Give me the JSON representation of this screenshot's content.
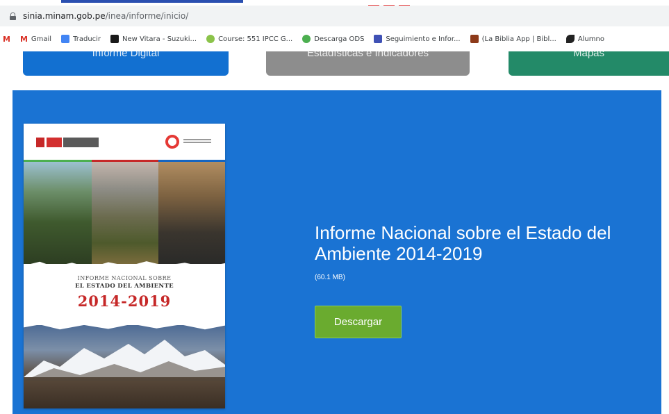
{
  "browser": {
    "url_host": "sinia.minam.gob.pe",
    "url_path": "/inea/informe/inicio/"
  },
  "bookmarks": [
    {
      "label": "",
      "icon": "gmail-icon",
      "color": "#d93025"
    },
    {
      "label": "Gmail",
      "icon": "gmail-icon",
      "color": "#d93025"
    },
    {
      "label": "Traducir",
      "icon": "translate-icon",
      "color": "#4285f4"
    },
    {
      "label": "New Vitara - Suzuki...",
      "icon": "suzuki-icon",
      "color": "#1a1a1a"
    },
    {
      "label": "Course: 551 IPCC G...",
      "icon": "course-icon",
      "color": "#8bc34a"
    },
    {
      "label": "Descarga ODS",
      "icon": "download-ods-icon",
      "color": "#4caf50"
    },
    {
      "label": "Seguimiento e Infor...",
      "icon": "chart-icon",
      "color": "#3f51b5"
    },
    {
      "label": "(La Biblia App | Bibl...",
      "icon": "bible-icon",
      "color": "#8d3a1a"
    },
    {
      "label": "Alumno",
      "icon": "bird-icon",
      "color": "#222222"
    }
  ],
  "tabs": {
    "informe": "Informe Digital",
    "estadisticas": "Estadísticas e Indicadores",
    "mapas": "Mapas"
  },
  "colors": {
    "hero_blue": "#1a73d3",
    "tab_blue": "#1270d1",
    "tab_grey": "#8d8d8d",
    "tab_green": "#238a68",
    "button_green": "#6aab2f",
    "cover_red": "#c62828"
  },
  "cover": {
    "line1": "INFORME NACIONAL SOBRE",
    "line2": "EL ESTADO DEL AMBIENTE",
    "years": "2014-2019"
  },
  "hero": {
    "title": "Informe Nacional sobre el Estado del Ambiente 2014-2019",
    "file_size": "(60.1 MB)",
    "download_label": "Descargar"
  }
}
